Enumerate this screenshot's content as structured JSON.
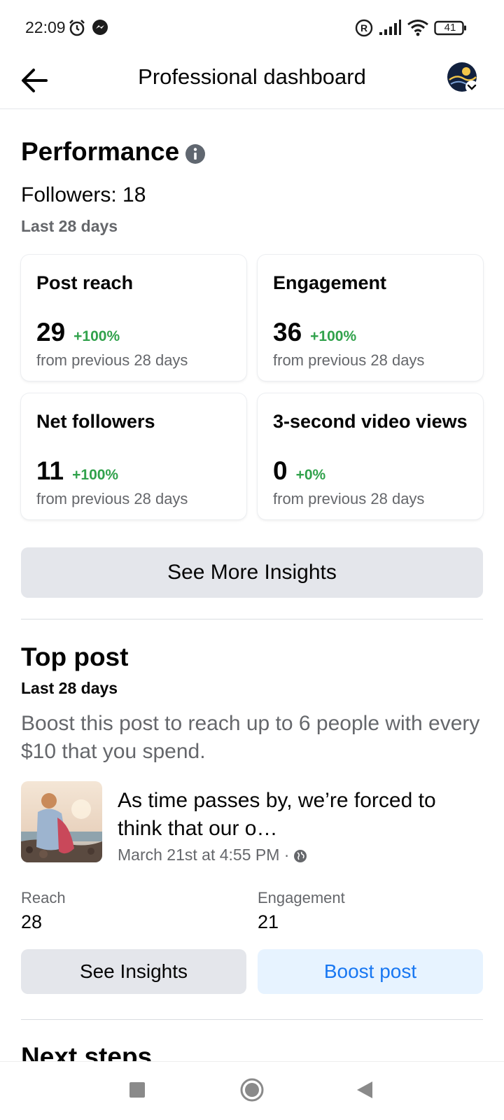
{
  "status_bar": {
    "time": "22:09",
    "battery": "41",
    "icons": [
      "alarm-icon",
      "messenger-icon",
      "registered-icon",
      "signal-icon",
      "wifi-icon",
      "battery-icon"
    ]
  },
  "header": {
    "title": "Professional dashboard",
    "back_icon": "back-arrow-icon",
    "avatar": "profile-avatar"
  },
  "performance": {
    "title": "Performance",
    "followers": "Followers: 18",
    "period": "Last 28 days",
    "cards": [
      {
        "title": "Post reach",
        "value": "29",
        "change": "+100%",
        "sub": "from previous 28 days"
      },
      {
        "title": "Engagement",
        "value": "36",
        "change": "+100%",
        "sub": "from previous 28 days"
      },
      {
        "title": "Net followers",
        "value": "11",
        "change": "+100%",
        "sub": "from previous 28 days"
      },
      {
        "title": "3-second video views",
        "value": "0",
        "change": "+0%",
        "sub": "from previous 28 days"
      }
    ],
    "see_more_label": "See More Insights"
  },
  "top_post": {
    "title": "Top post",
    "period": "Last 28 days",
    "boost_description": "Boost this post to reach up to 6 people with every $10 that you spend.",
    "post_text": "As time passes by, we’re forced to think that our o…",
    "post_date": "March 21st at 4:55 PM ·",
    "reach_label": "Reach",
    "reach_value": "28",
    "engagement_label": "Engagement",
    "engagement_value": "21",
    "see_insights_label": "See Insights",
    "boost_label": "Boost post"
  },
  "next_steps": {
    "title": "Next steps"
  },
  "colors": {
    "positive": "#31a24c",
    "brand_blue": "#1877f2",
    "button_grey": "#e4e6eb",
    "button_blue_bg": "#e7f3ff"
  }
}
